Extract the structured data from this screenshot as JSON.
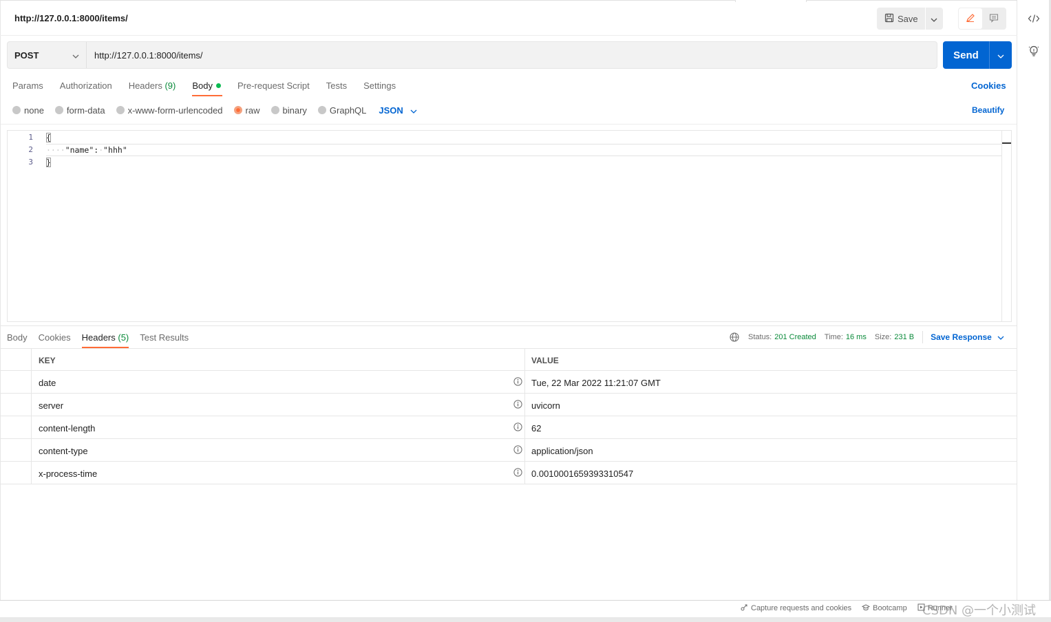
{
  "title": "http://127.0.0.1:8000/items/",
  "toolbar": {
    "save_label": "Save"
  },
  "request": {
    "method": "POST",
    "url": "http://127.0.0.1:8000/items/",
    "send_label": "Send"
  },
  "req_tabs": [
    {
      "label": "Params"
    },
    {
      "label": "Authorization"
    },
    {
      "label": "Headers",
      "count": "(9)"
    },
    {
      "label": "Body",
      "active": true
    },
    {
      "label": "Pre-request Script"
    },
    {
      "label": "Tests"
    },
    {
      "label": "Settings"
    }
  ],
  "cookies_label": "Cookies",
  "body_types": [
    "none",
    "form-data",
    "x-www-form-urlencoded",
    "raw",
    "binary",
    "GraphQL"
  ],
  "body_type_selected": "raw",
  "body_format": "JSON",
  "beautify_label": "Beautify",
  "editor": {
    "line_numbers": [
      "1",
      "2",
      "3"
    ],
    "line1": "{",
    "line2_indent": "····",
    "line2_key": "\"name\"",
    "line2_colon": ":",
    "line2_space": "·",
    "line2_value": "\"hhh\"",
    "line3": "}"
  },
  "res_tabs": [
    {
      "label": "Body"
    },
    {
      "label": "Cookies"
    },
    {
      "label": "Headers",
      "count": "(5)",
      "active": true
    },
    {
      "label": "Test Results"
    }
  ],
  "status": {
    "status_label": "Status:",
    "status_value": "201 Created",
    "time_label": "Time:",
    "time_value": "16 ms",
    "size_label": "Size:",
    "size_value": "231 B",
    "save_response_label": "Save Response"
  },
  "headers_table": {
    "columns": [
      "KEY",
      "VALUE"
    ],
    "rows": [
      {
        "key": "date",
        "value": "Tue, 22 Mar 2022 11:21:07 GMT"
      },
      {
        "key": "server",
        "value": "uvicorn"
      },
      {
        "key": "content-length",
        "value": "62"
      },
      {
        "key": "content-type",
        "value": "application/json"
      },
      {
        "key": "x-process-time",
        "value": "0.0010001659393310547"
      }
    ]
  },
  "footer": {
    "capture_label": "Capture requests and cookies",
    "bootcamp_label": "Bootcamp",
    "runner_label": "Runner",
    "watermark": "CSDN @一个小测试"
  },
  "colors": {
    "accent": "#ff6c37",
    "primary": "#0265d2",
    "success": "#0a8a3a"
  }
}
